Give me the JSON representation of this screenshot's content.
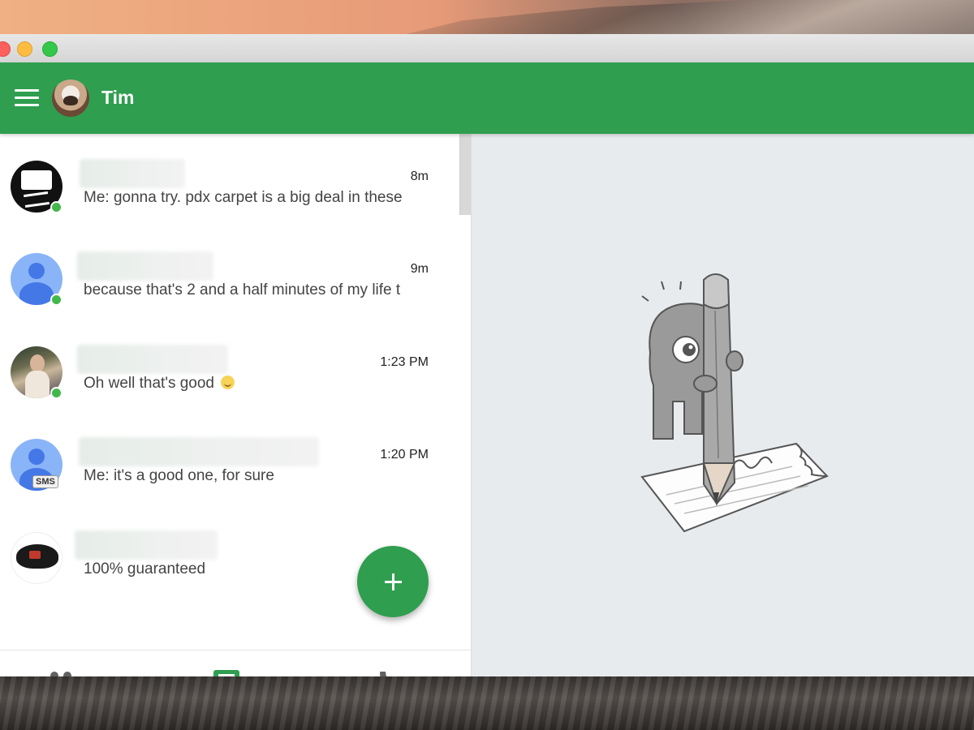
{
  "window": {
    "traffic_lights": [
      "close",
      "minimize",
      "zoom"
    ]
  },
  "appbar": {
    "user_name": "Tim",
    "color": "#2f9e4f"
  },
  "conversations": [
    {
      "time": "8m",
      "snippet": "Me: gonna try. pdx carpet is a big deal in these",
      "online": true,
      "avatar": "cassette-skull"
    },
    {
      "time": "9m",
      "snippet": "because that's 2 and a half minutes of my life t",
      "online": true,
      "avatar": "default-person"
    },
    {
      "time": "1:23 PM",
      "snippet": "Oh well that's good",
      "online": true,
      "avatar": "photo"
    },
    {
      "time": "1:20 PM",
      "snippet": "Me: it's a good one, for sure",
      "online": false,
      "avatar": "default-person",
      "badge": "SMS"
    },
    {
      "time": "",
      "snippet": "100% guaranteed",
      "online": false,
      "avatar": "hat"
    }
  ],
  "bottom_nav": {
    "tabs": [
      "people-icon",
      "messages-icon",
      "phone-icon"
    ],
    "active": "messages-icon"
  },
  "fab": {
    "icon": "plus-icon"
  },
  "empty_state": {
    "illustration": "character-with-pencil"
  }
}
